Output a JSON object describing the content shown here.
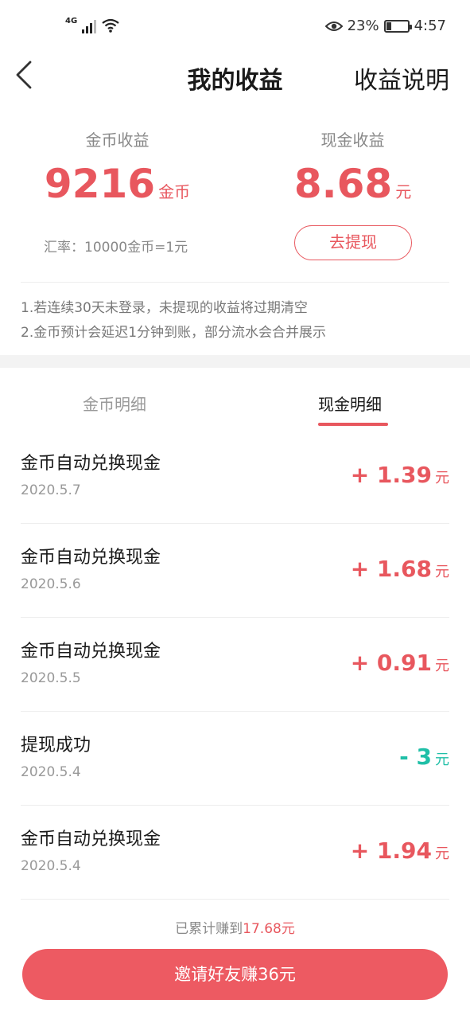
{
  "status": {
    "network": "4G",
    "signal_level": 3,
    "battery_percent": "23%",
    "battery_level": 0.23,
    "time": "4:57",
    "icons": [
      "signal-icon",
      "wifi-icon",
      "eye-comfort-icon",
      "battery-icon"
    ]
  },
  "nav": {
    "title": "我的收益",
    "right_link": "收益说明",
    "back_icon": "chevron-left-icon"
  },
  "summary": {
    "coin": {
      "label": "金币收益",
      "value": "9216",
      "unit": "金币"
    },
    "cash": {
      "label": "现金收益",
      "value": "8.68",
      "unit": "元"
    },
    "rate": "汇率：10000金币=1元",
    "withdraw_button": "去提现"
  },
  "notes": [
    "1.若连续30天未登录，未提现的收益将过期清空",
    "2.金币预计会延迟1分钟到账，部分流水会合并展示"
  ],
  "tabs": [
    {
      "label": "金币明细",
      "active": false
    },
    {
      "label": "现金明细",
      "active": true
    }
  ],
  "records": [
    {
      "title": "金币自动兑换现金",
      "date": "2020.5.7",
      "amount": "+ 1.39",
      "unit": "元",
      "type": "income"
    },
    {
      "title": "金币自动兑换现金",
      "date": "2020.5.6",
      "amount": "+ 1.68",
      "unit": "元",
      "type": "income"
    },
    {
      "title": "金币自动兑换现金",
      "date": "2020.5.5",
      "amount": "+ 0.91",
      "unit": "元",
      "type": "income"
    },
    {
      "title": "提现成功",
      "date": "2020.5.4",
      "amount": "- 3",
      "unit": "元",
      "type": "expense"
    },
    {
      "title": "金币自动兑换现金",
      "date": "2020.5.4",
      "amount": "+ 1.94",
      "unit": "元",
      "type": "income"
    }
  ],
  "footer": {
    "total_prefix": "已累计赚到",
    "total_value": "17.68元",
    "invite_button": "邀请好友赚36元"
  },
  "colors": {
    "accent": "#e8575e",
    "income": "#e8575e",
    "expense": "#1fbfa7",
    "button": "#ed5a62"
  }
}
